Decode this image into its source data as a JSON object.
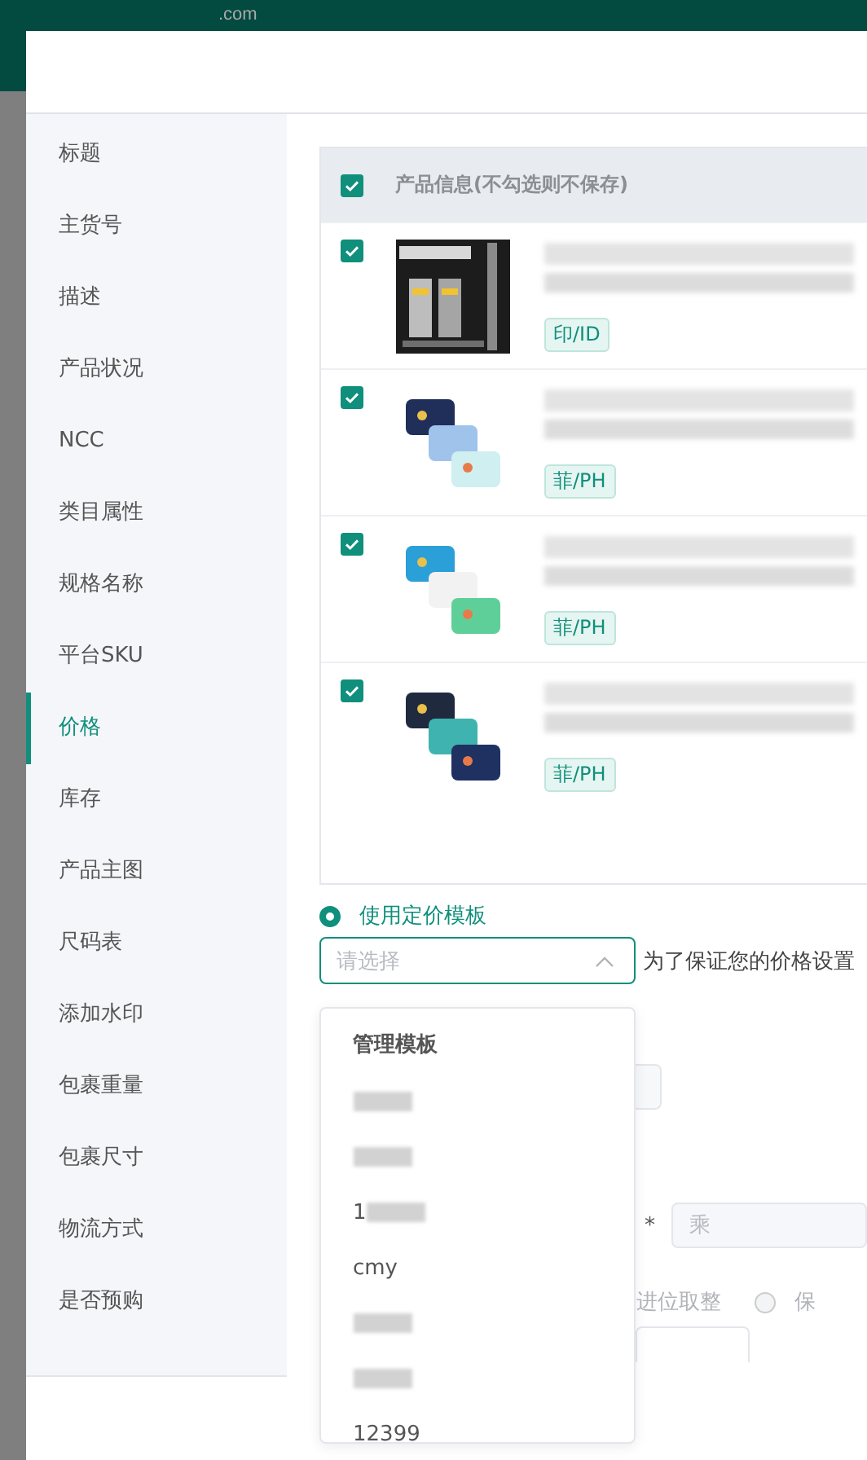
{
  "background": {
    "logo_suffix": ".com"
  },
  "sidebar": {
    "items": [
      {
        "label": "标题",
        "selected": false
      },
      {
        "label": "主货号",
        "selected": false
      },
      {
        "label": "描述",
        "selected": false
      },
      {
        "label": "产品状况",
        "selected": false
      },
      {
        "label": "NCC",
        "selected": false
      },
      {
        "label": "类目属性",
        "selected": false
      },
      {
        "label": "规格名称",
        "selected": false
      },
      {
        "label": "平台SKU",
        "selected": false
      },
      {
        "label": "价格",
        "selected": true
      },
      {
        "label": "库存",
        "selected": false
      },
      {
        "label": "产品主图",
        "selected": false
      },
      {
        "label": "尺码表",
        "selected": false
      },
      {
        "label": "添加水印",
        "selected": false
      },
      {
        "label": "包裹重量",
        "selected": false
      },
      {
        "label": "包裹尺寸",
        "selected": false
      },
      {
        "label": "物流方式",
        "selected": false
      },
      {
        "label": "是否预购",
        "selected": false
      }
    ]
  },
  "table": {
    "header": {
      "label": "产品信息(不勾选则不保存)",
      "checked": true
    },
    "rows": [
      {
        "checked": true,
        "tag": "印/ID"
      },
      {
        "checked": true,
        "tag": "菲/PH"
      },
      {
        "checked": true,
        "tag": "菲/PH"
      },
      {
        "checked": true,
        "tag": "菲/PH"
      }
    ]
  },
  "pricing": {
    "radio": {
      "label": "使用定价模板",
      "selected": true
    },
    "select": {
      "placeholder": "请选择",
      "expanded": true
    },
    "hint": "为了保证您的价格设置",
    "dropdown": {
      "group_title": "管理模板",
      "options": [
        {
          "kind": "blurred"
        },
        {
          "kind": "blurred"
        },
        {
          "kind": "text",
          "label": "1"
        },
        {
          "kind": "text",
          "label": "cmy"
        },
        {
          "kind": "blurred"
        },
        {
          "kind": "blurred"
        },
        {
          "kind": "text",
          "label": "12399"
        }
      ]
    },
    "star": "*",
    "multiply_placeholder": "乘",
    "rounding_label": "进位取整",
    "keep_option": {
      "label": "保",
      "selected": false
    }
  }
}
